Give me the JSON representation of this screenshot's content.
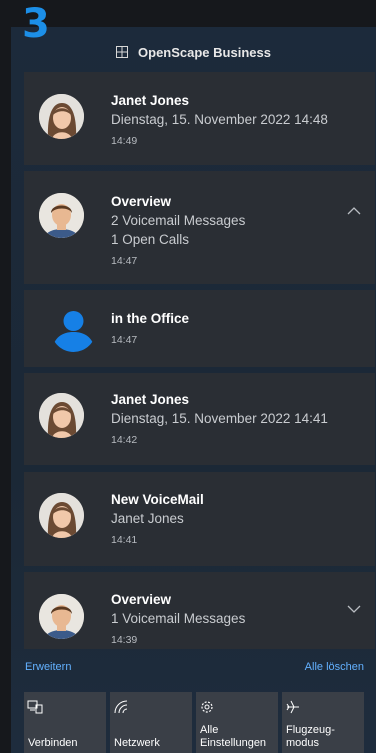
{
  "step_number": "3",
  "header": {
    "app_name": "OpenScape Business",
    "icon": "grid-icon"
  },
  "notifications": [
    {
      "avatar": "woman",
      "title": "Janet Jones",
      "lines": [
        "Dienstag, 15. November 2022 14:48"
      ],
      "time": "14:49",
      "chevron": null
    },
    {
      "avatar": "man",
      "title": "Overview",
      "lines": [
        "2 Voicemail Messages",
        "1 Open Calls"
      ],
      "time": "14:47",
      "chevron": "up"
    },
    {
      "avatar": "person-icon",
      "title": "in the Office",
      "lines": [],
      "time": "14:47",
      "chevron": null
    },
    {
      "avatar": "woman",
      "title": "Janet Jones",
      "lines": [
        "Dienstag, 15. November 2022 14:41"
      ],
      "time": "14:42",
      "chevron": null
    },
    {
      "avatar": "woman",
      "title": "New VoiceMail",
      "lines": [
        "Janet Jones"
      ],
      "time": "14:41",
      "chevron": null
    },
    {
      "avatar": "man",
      "title": "Overview",
      "lines": [
        "1 Voicemail Messages"
      ],
      "time": "14:39",
      "chevron": "down"
    }
  ],
  "footer": {
    "expand_label": "Erweitern",
    "clear_all_label": "Alle löschen"
  },
  "quick_actions": [
    {
      "icon": "connect-icon",
      "label": "Verbinden"
    },
    {
      "icon": "network-icon",
      "label": "Netzwerk"
    },
    {
      "icon": "gear-icon",
      "label": "Alle Einstellungen"
    },
    {
      "icon": "airplane-icon",
      "label": "Flugzeug-modus"
    }
  ],
  "colors": {
    "accent": "#1c8fe8",
    "link": "#63b1ff",
    "card": "#2a2e34",
    "tile": "#3a3f47"
  }
}
